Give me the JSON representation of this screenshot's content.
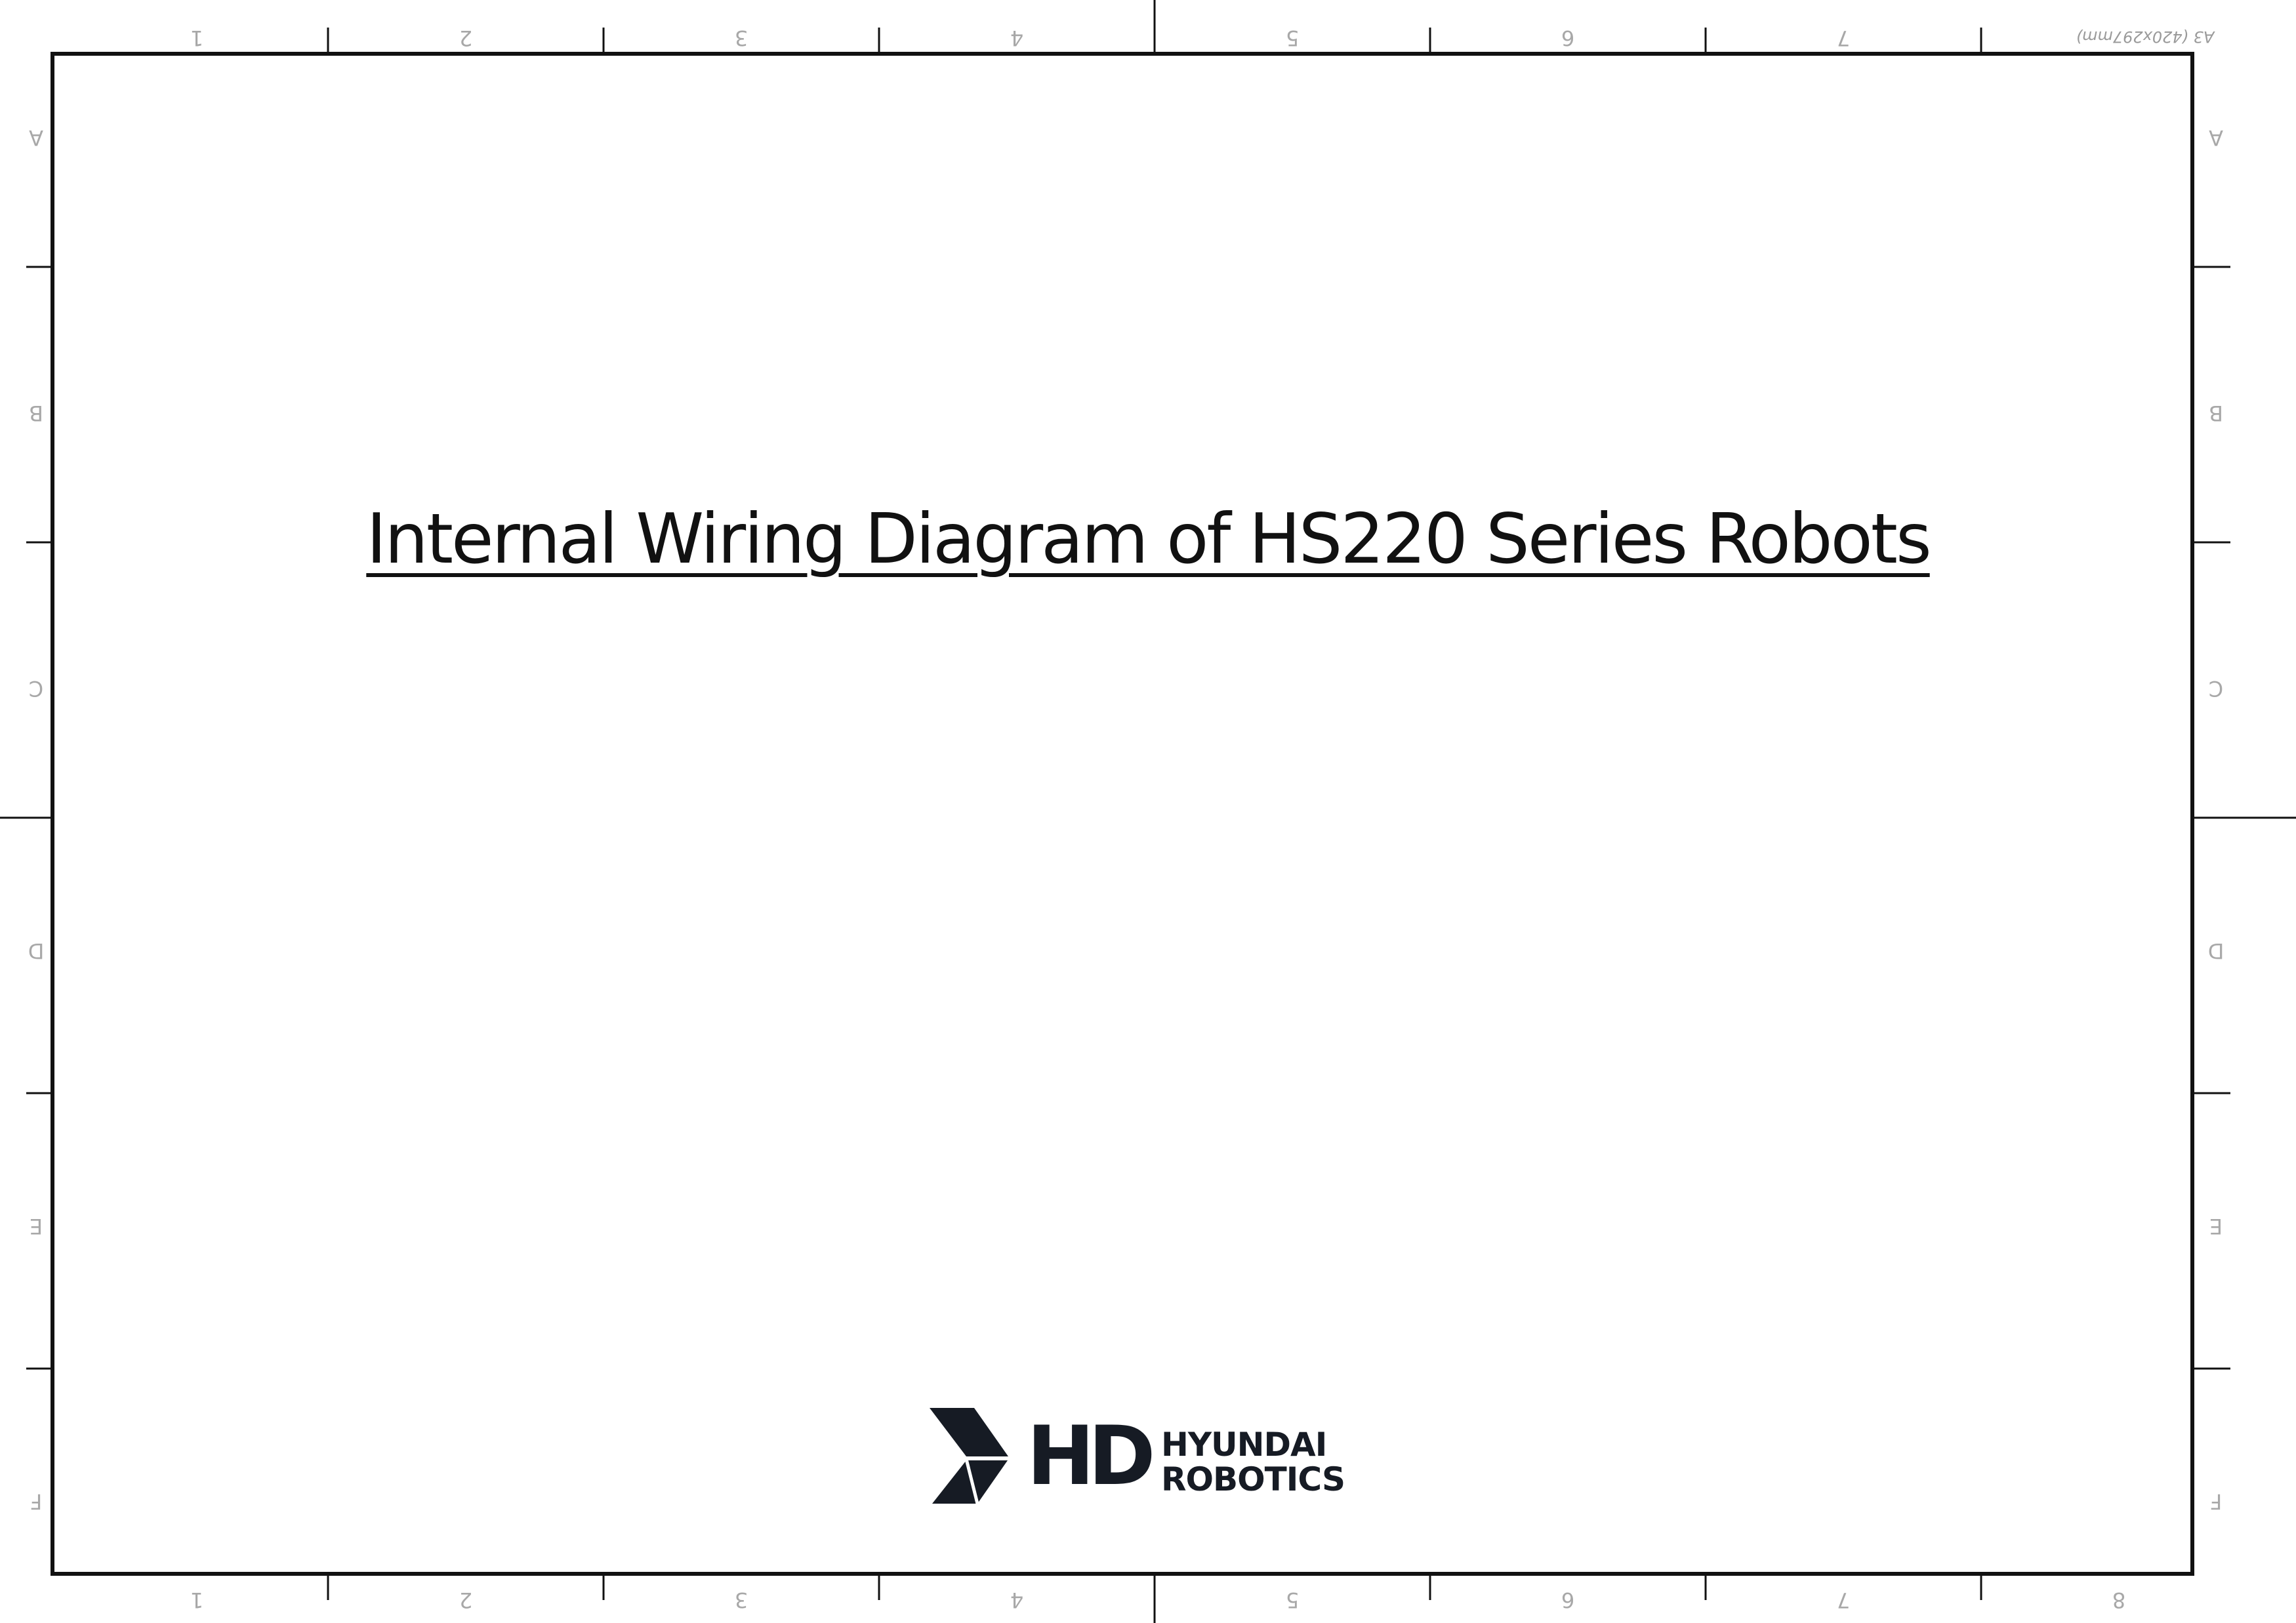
{
  "drawing_sheet": {
    "sheet_size": "A3 (420x297mm)",
    "column_labels": [
      "1",
      "2",
      "3",
      "4",
      "5",
      "6",
      "7",
      "8"
    ],
    "row_labels": [
      "A",
      "B",
      "C",
      "D",
      "E",
      "F"
    ]
  },
  "document": {
    "title": "Internal Wiring Diagram of HS220 Series Robots"
  },
  "logo": {
    "wordmark": "HD",
    "line1": "HYUNDAI",
    "line2": "ROBOTICS",
    "color": "#161b24"
  },
  "colors": {
    "frame": "#111111",
    "zone_label": "#a8a8a8",
    "background": "#ffffff"
  }
}
